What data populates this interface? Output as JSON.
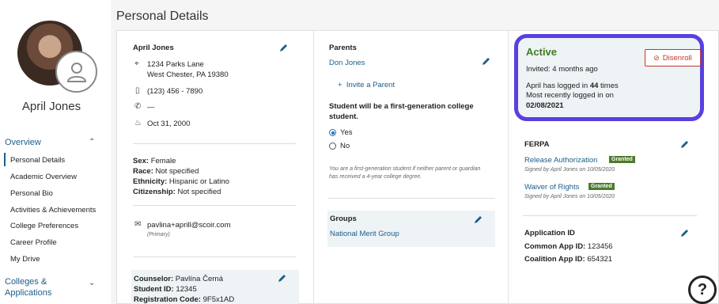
{
  "page": {
    "title": "Personal Details"
  },
  "sidebar": {
    "student_name": "April Jones",
    "sections": [
      {
        "label": "Overview",
        "caret": "⌃"
      },
      {
        "label": "Colleges & Applications",
        "caret": "⌄"
      }
    ],
    "items": [
      {
        "label": "Personal Details"
      },
      {
        "label": "Academic Overview"
      },
      {
        "label": "Personal Bio"
      },
      {
        "label": "Activities & Achievements"
      },
      {
        "label": "College Preferences"
      },
      {
        "label": "Career Profile"
      },
      {
        "label": "My Drive"
      }
    ]
  },
  "profile": {
    "name": "April Jones",
    "address_line1": "1234 Parks Lane",
    "address_line2": "West Chester, PA 19380",
    "phone": "(123) 456 - 7890",
    "alt_phone": "—",
    "birthday": "Oct 31, 2000",
    "sex_label": "Sex:",
    "sex": "Female",
    "race_label": "Race:",
    "race": "Not specified",
    "ethnicity_label": "Ethnicity:",
    "ethnicity": "Hispanic or Latino",
    "citizenship_label": "Citizenship:",
    "citizenship": "Not specified",
    "email": "pavlina+aprill@scoir.com",
    "email_type": "(Primary)"
  },
  "counselor": {
    "counselor_label": "Counselor:",
    "counselor": "Pavlína Černá",
    "student_id_label": "Student ID:",
    "student_id": "12345",
    "reg_code_label": "Registration Code:",
    "reg_code": "9F5x1AD"
  },
  "parents": {
    "heading": "Parents",
    "parent_name": "Don Jones",
    "invite_label": "Invite a Parent",
    "question": "Student will be a first-generation college student.",
    "options": [
      {
        "label": "Yes",
        "selected": true
      },
      {
        "label": "No",
        "selected": false
      }
    ],
    "note": "You are a first-generation student if neither parent or guardian has received a 4-year college degree."
  },
  "groups": {
    "heading": "Groups",
    "group_name": "National Merit Group"
  },
  "status": {
    "title": "Active",
    "invited": "Invited: 4 months ago",
    "logins_prefix": "April has logged in ",
    "logins_count": "44",
    "logins_suffix": " times",
    "recent_label": "Most recently logged in on",
    "recent_date": "02/08/2021",
    "disenroll_label": "Disenroll"
  },
  "ferpa": {
    "heading": "FERPA",
    "items": [
      {
        "title": "Release Authorization",
        "badge": "Granted",
        "signed": "Signed by April Jones on 10/05/2020"
      },
      {
        "title": "Waiver of Rights",
        "badge": "Granted",
        "signed": "Signed by April Jones on 10/05/2020"
      }
    ]
  },
  "application_id": {
    "heading": "Application ID",
    "common_label": "Common App ID:",
    "common": "123456",
    "coalition_label": "Coalition App ID:",
    "coalition": "654321"
  },
  "help": {
    "glyph": "?"
  },
  "colors": {
    "accent": "#1b5e8a",
    "highlight_ring": "#5a3fe0",
    "granted": "#4c7a2c",
    "disenroll": "#c0392b"
  }
}
